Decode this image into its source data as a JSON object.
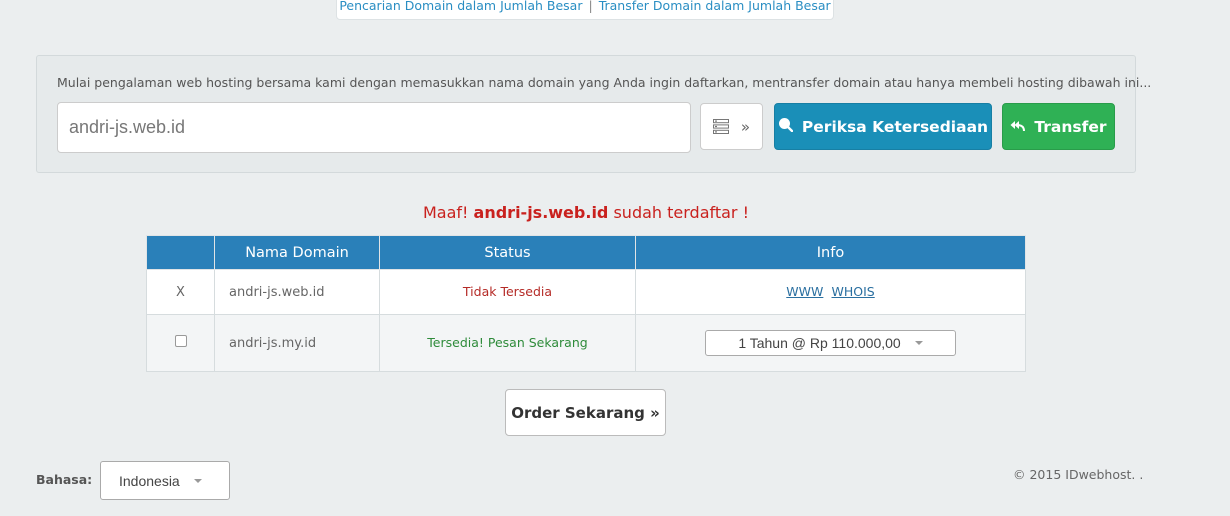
{
  "top_links": {
    "bulk_search": "Pencarian Domain dalam Jumlah Besar",
    "separator": "|",
    "bulk_transfer": "Transfer Domain dalam Jumlah Besar"
  },
  "search": {
    "intro": "Mulai pengalaman web hosting bersama kami dengan memasukkan nama domain yang Anda ingin daftarkan, mentransfer domain atau hanya membeli hosting dibawah ini...",
    "domain_value": "andri-js.web.id",
    "bulk_toggle_label": "»",
    "check_label": "Periksa Ketersediaan",
    "transfer_label": "Transfer"
  },
  "result_message": {
    "prefix": "Maaf! ",
    "domain": "andri-js.web.id",
    "suffix": " sudah terdaftar !"
  },
  "table": {
    "headers": [
      "",
      "Nama Domain",
      "Status",
      "Info"
    ],
    "rows": [
      {
        "select": "X",
        "domain": "andri-js.web.id",
        "status": "Tidak Tersedia",
        "info_links": [
          "WWW",
          "WHOIS"
        ]
      },
      {
        "select": "",
        "domain": "andri-js.my.id",
        "status": "Tersedia! Pesan Sekarang",
        "price_option": "1 Tahun @ Rp 110.000,00"
      }
    ]
  },
  "order_label": "Order Sekarang »",
  "footer": {
    "language_label": "Bahasa:",
    "language_value": "Indonesia",
    "copyright": "© 2015 IDwebhost. ."
  },
  "icons": {
    "bulk": "list-icon",
    "check": "search-icon",
    "transfer": "reply-all-icon"
  },
  "colors": {
    "check_button": "#1a8fb8",
    "transfer_button": "#2fb155",
    "table_header": "#2a80b9",
    "error_text": "#c9211e",
    "available_text": "#2e8b3a"
  }
}
